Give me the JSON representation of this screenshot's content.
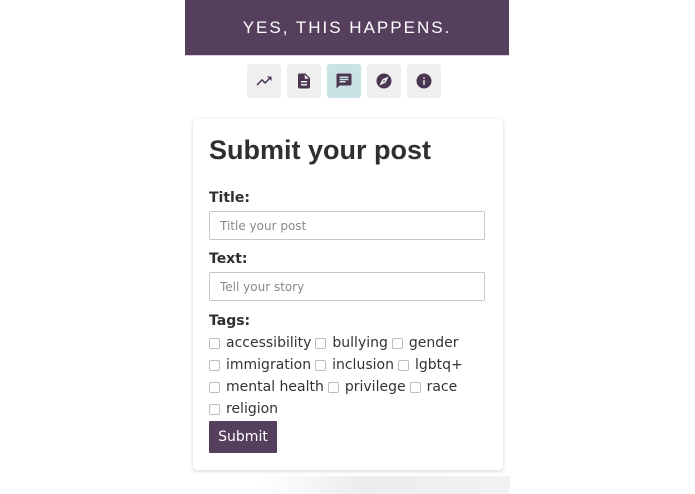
{
  "header": {
    "title": "YES, THIS HAPPENS."
  },
  "nav": {
    "items": [
      {
        "icon": "trending-up-icon",
        "active": false
      },
      {
        "icon": "document-icon",
        "active": false
      },
      {
        "icon": "chat-post-icon",
        "active": true
      },
      {
        "icon": "compass-icon",
        "active": false
      },
      {
        "icon": "info-icon",
        "active": false
      }
    ],
    "active_color": "#c9e2e6"
  },
  "form": {
    "heading": "Submit your post",
    "title_label": "Title:",
    "title_value": "",
    "title_placeholder": "Title your post",
    "text_label": "Text:",
    "text_value": "",
    "text_placeholder": "Tell your story",
    "tags_label": "Tags:",
    "tags": [
      [
        "accessibility",
        "bullying",
        "gender"
      ],
      [
        "immigration",
        "inclusion",
        "lgbtq+"
      ],
      [
        "mental health",
        "privilege",
        "race"
      ],
      [
        "religion"
      ]
    ],
    "submit_label": "Submit"
  },
  "colors": {
    "brand": "#563f5c",
    "active_nav": "#c9e2e6"
  }
}
